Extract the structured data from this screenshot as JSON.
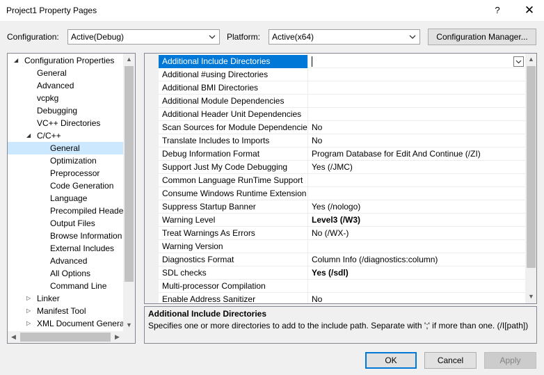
{
  "window": {
    "title": "Project1 Property Pages",
    "help": "?",
    "close": "✕"
  },
  "config": {
    "configuration_label": "Configuration:",
    "configuration_value": "Active(Debug)",
    "platform_label": "Platform:",
    "platform_value": "Active(x64)",
    "manager_button": "Configuration Manager..."
  },
  "tree": {
    "items": [
      {
        "label": "Configuration Properties",
        "level": 0,
        "expander": "open"
      },
      {
        "label": "General",
        "level": 1
      },
      {
        "label": "Advanced",
        "level": 1
      },
      {
        "label": "vcpkg",
        "level": 1
      },
      {
        "label": "Debugging",
        "level": 1
      },
      {
        "label": "VC++ Directories",
        "level": 1
      },
      {
        "label": "C/C++",
        "level": 1,
        "expander": "open"
      },
      {
        "label": "General",
        "level": 2,
        "selected": true
      },
      {
        "label": "Optimization",
        "level": 2
      },
      {
        "label": "Preprocessor",
        "level": 2
      },
      {
        "label": "Code Generation",
        "level": 2
      },
      {
        "label": "Language",
        "level": 2
      },
      {
        "label": "Precompiled Heade",
        "level": 2
      },
      {
        "label": "Output Files",
        "level": 2
      },
      {
        "label": "Browse Information",
        "level": 2
      },
      {
        "label": "External Includes",
        "level": 2
      },
      {
        "label": "Advanced",
        "level": 2
      },
      {
        "label": "All Options",
        "level": 2
      },
      {
        "label": "Command Line",
        "level": 2
      },
      {
        "label": "Linker",
        "level": 1,
        "expander": "closed"
      },
      {
        "label": "Manifest Tool",
        "level": 1,
        "expander": "closed"
      },
      {
        "label": "XML Document Genera",
        "level": 1,
        "expander": "closed"
      }
    ]
  },
  "grid": {
    "rows": [
      {
        "name": "Additional Include Directories",
        "value": "",
        "selected": true
      },
      {
        "name": "Additional #using Directories",
        "value": ""
      },
      {
        "name": "Additional BMI Directories",
        "value": ""
      },
      {
        "name": "Additional Module Dependencies",
        "value": ""
      },
      {
        "name": "Additional Header Unit Dependencies",
        "value": ""
      },
      {
        "name": "Scan Sources for Module Dependencies",
        "value": "No"
      },
      {
        "name": "Translate Includes to Imports",
        "value": "No"
      },
      {
        "name": "Debug Information Format",
        "value": "Program Database for Edit And Continue (/ZI)"
      },
      {
        "name": "Support Just My Code Debugging",
        "value": "Yes (/JMC)"
      },
      {
        "name": "Common Language RunTime Support",
        "value": ""
      },
      {
        "name": "Consume Windows Runtime Extension",
        "value": ""
      },
      {
        "name": "Suppress Startup Banner",
        "value": "Yes (/nologo)"
      },
      {
        "name": "Warning Level",
        "value": "Level3 (/W3)",
        "bold": true
      },
      {
        "name": "Treat Warnings As Errors",
        "value": "No (/WX-)"
      },
      {
        "name": "Warning Version",
        "value": ""
      },
      {
        "name": "Diagnostics Format",
        "value": "Column Info (/diagnostics:column)"
      },
      {
        "name": "SDL checks",
        "value": "Yes (/sdl)",
        "bold": true
      },
      {
        "name": "Multi-processor Compilation",
        "value": ""
      },
      {
        "name": "Enable Address Sanitizer",
        "value": "No"
      }
    ]
  },
  "description": {
    "title": "Additional Include Directories",
    "text": "Specifies one or more directories to add to the include path. Separate with ';' if more than one. (/I[path])"
  },
  "buttons": {
    "ok": "OK",
    "cancel": "Cancel",
    "apply": "Apply"
  },
  "colors": {
    "selection_blue": "#0078d7",
    "tree_selection": "#cce8ff",
    "default_button_border": "#0078d7"
  },
  "icons": [
    "help-icon",
    "close-icon",
    "chevron-down-icon",
    "tree-expand-icon",
    "scroll-arrow-icon"
  ]
}
